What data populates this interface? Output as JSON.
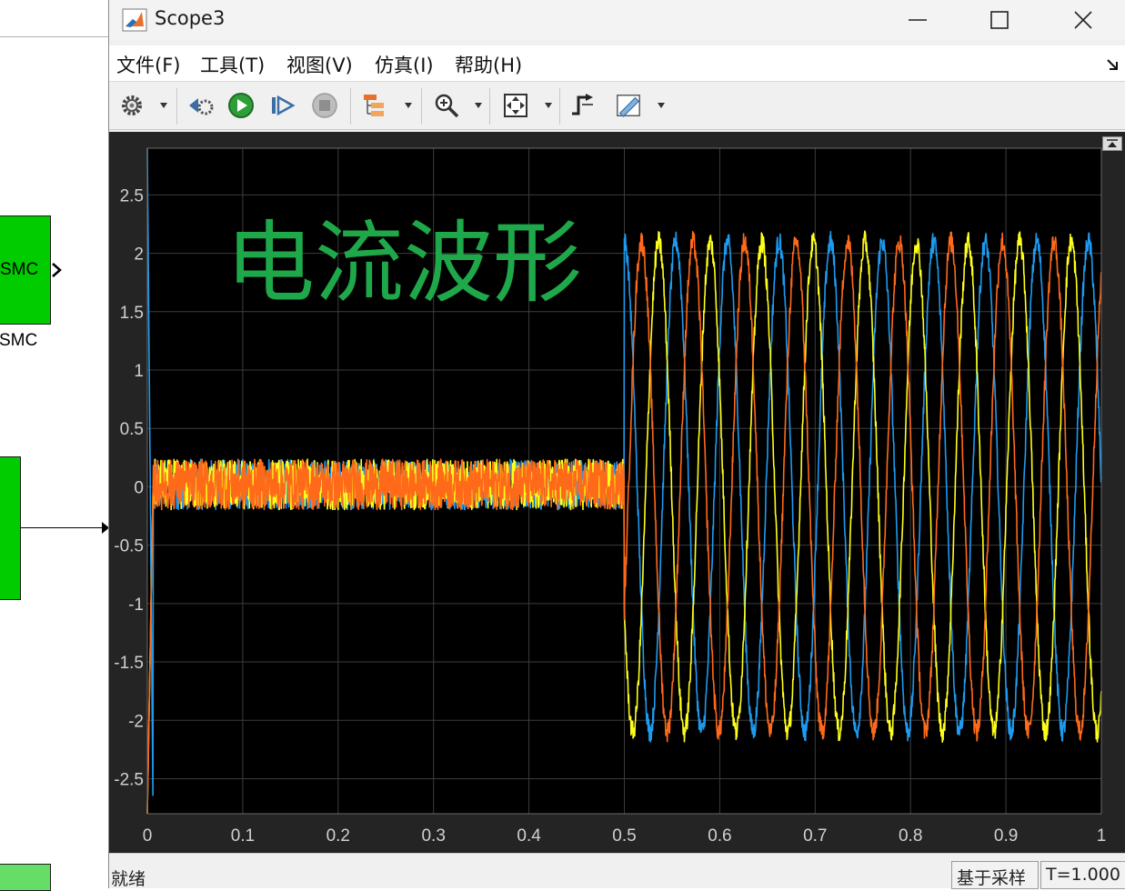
{
  "background_model": {
    "smc_block_label": "SMC",
    "smc_block_name": "SMC",
    "block_color": "#00cc00"
  },
  "window": {
    "title": "Scope3"
  },
  "menu": {
    "items": [
      "文件(F)",
      "工具(T)",
      "视图(V)",
      "仿真(I)",
      "帮助(H)"
    ]
  },
  "toolbar": {
    "icons": [
      "settings-icon",
      "step-back-icon",
      "run-icon",
      "step-forward-icon",
      "stop-icon",
      "signal-hierarchy-icon",
      "zoom-in-icon",
      "fit-to-view-icon",
      "triggers-icon",
      "measurements-icon"
    ]
  },
  "annotation": {
    "text": "电流波形",
    "color": "#1fa84a"
  },
  "status": {
    "state": "就绪",
    "sampling": "基于采样",
    "time": "T=1.000"
  },
  "colors": {
    "plot_background": "#000000",
    "axes_frame": "#242424",
    "series_1": "#1e9bf0",
    "series_2": "#ff6a1a",
    "series_3": "#ffff1a"
  },
  "chart_data": {
    "type": "line",
    "title": "",
    "xlabel": "",
    "ylabel": "",
    "xlim": [
      0,
      1
    ],
    "ylim": [
      -2.8,
      2.9
    ],
    "grid": true,
    "x_ticks": [
      "0",
      "0.1",
      "0.2",
      "0.3",
      "0.4",
      "0.5",
      "0.6",
      "0.7",
      "0.8",
      "0.9",
      "1"
    ],
    "y_ticks": [
      "2.5",
      "2",
      "1.5",
      "1",
      "0.5",
      "0",
      "-0.5",
      "-1",
      "-1.5",
      "-2",
      "-2.5"
    ],
    "y_tick_values": [
      2.5,
      2,
      1.5,
      1,
      0.5,
      0,
      -0.5,
      -1,
      -1.5,
      -2,
      -2.5
    ],
    "series": [
      {
        "color": "#1e9bf0",
        "noise_phase_amplitude": 0.12,
        "sine_amplitude": 2.1,
        "frequency_hz": 18.5,
        "phase_deg": 90,
        "step_time": 0.5
      },
      {
        "color": "#ff6a1a",
        "noise_phase_amplitude": 0.12,
        "sine_amplitude": 2.1,
        "frequency_hz": 18.5,
        "phase_deg": -30,
        "step_time": 0.5
      },
      {
        "color": "#ffff1a",
        "noise_phase_amplitude": 0.12,
        "sine_amplitude": 2.1,
        "frequency_hz": 18.5,
        "phase_deg": 210,
        "step_time": 0.5
      }
    ]
  }
}
